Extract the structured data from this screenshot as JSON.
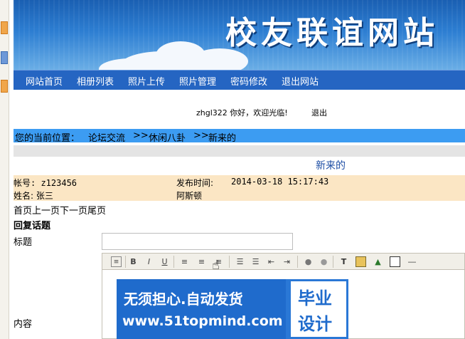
{
  "banner": {
    "title": "校友联谊网站"
  },
  "nav": {
    "items": [
      "网站首页",
      "相册列表",
      "照片上传",
      "照片管理",
      "密码修改",
      "退出网站"
    ]
  },
  "user_bar": {
    "welcome": "zhgl322 你好，欢迎光临!",
    "logout": "退出"
  },
  "breadcrumb": {
    "prefix": "您的当前位置：",
    "items": [
      "论坛交流",
      ">>",
      "休闲八卦",
      ">>",
      "新来的"
    ]
  },
  "post": {
    "title": "新来的",
    "account_label": "帐号: z123456",
    "name_label": "姓名: 张三",
    "time_label": "发布时间:",
    "time_value": "2014-03-18 15:17:43",
    "content_preview": "阿斯顿"
  },
  "pager": {
    "text": "首页上一页下一页尾页"
  },
  "reply": {
    "heading": "回复话题",
    "title_label": "标题",
    "content_label": "内容",
    "title_value": ""
  },
  "toolbar": {
    "buttons": [
      "source-icon",
      "bold-icon",
      "italic-icon",
      "underline-icon",
      "align-left-icon",
      "align-center-icon",
      "align-right-icon",
      "ordered-list-icon",
      "unordered-list-icon",
      "outdent-icon",
      "indent-icon",
      "link-icon",
      "unlink-icon",
      "text-color-icon",
      "image-icon",
      "flash-icon",
      "table-icon",
      "hr-icon"
    ],
    "bold": "B",
    "italic": "I",
    "underline": "U"
  },
  "watermark": {
    "line1": "无须担心.自动发货",
    "line2": "www.51topmind.com",
    "badge1": "毕业",
    "badge2": "设计"
  },
  "colors": {
    "nav": "#2565c2",
    "crumb": "#3c9cf2",
    "info_row": "#fbe6c4"
  }
}
